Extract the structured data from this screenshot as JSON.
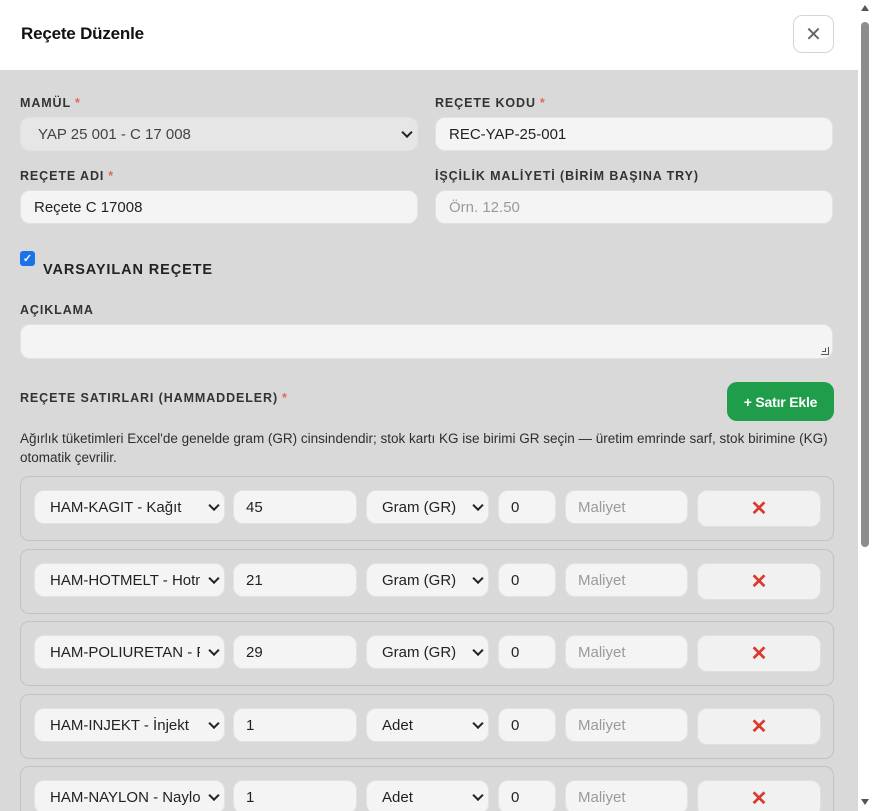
{
  "modal": {
    "title": "Reçete Düzenle",
    "close_icon": "close-icon"
  },
  "form": {
    "product": {
      "label": "MAMÜL",
      "required_mark": "*",
      "value": "YAP 25 001 - C 17 008"
    },
    "recipe_code": {
      "label": "REÇETE KODU",
      "required_mark": "*",
      "value": "REC-YAP-25-001"
    },
    "recipe_name": {
      "label": "REÇETE ADI",
      "required_mark": "*",
      "value": "Reçete C 17008"
    },
    "labor_cost": {
      "label": "İŞÇİLİK MALİYETİ (BİRİM BAŞINA TRY)",
      "placeholder": "Örn. 12.50"
    },
    "default_recipe": {
      "label": "VARSAYILAN REÇETE",
      "checked": true
    },
    "description": {
      "label": "AÇIKLAMA",
      "value": ""
    }
  },
  "lines": {
    "label": "REÇETE SATIRLARI (HAMMADDELER)",
    "required_mark": "*",
    "add_button": "+ Satır Ekle",
    "hint": "Ağırlık tüketimleri Excel'de genelde gram (GR) cinsindendir; stok kartı KG ise birimi GR seçin — üretim emrinde sarf, stok birimine (KG) otomatik çevrilir.",
    "cost_placeholder": "Maliyet",
    "delete_icon": "close-icon",
    "rows": [
      {
        "material": "HAM-KAGIT - Kağıt",
        "quantity": "45",
        "unit": "Gram (GR)",
        "waste": "0"
      },
      {
        "material": "HAM-HOTMELT - Hotmelt",
        "quantity": "21",
        "unit": "Gram (GR)",
        "waste": "0"
      },
      {
        "material": "HAM-POLIURETAN - Poliüretan",
        "quantity": "29",
        "unit": "Gram (GR)",
        "waste": "0"
      },
      {
        "material": "HAM-INJEKT - İnjekt",
        "quantity": "1",
        "unit": "Adet",
        "waste": "0"
      },
      {
        "material": "HAM-NAYLON - Naylon",
        "quantity": "1",
        "unit": "Adet",
        "waste": "0"
      }
    ]
  },
  "colors": {
    "accent_green": "#1f9d4a",
    "checkbox_blue": "#1a73e8",
    "delete_red": "#d93a2b",
    "overlay_gray": "#d9d9d9"
  }
}
